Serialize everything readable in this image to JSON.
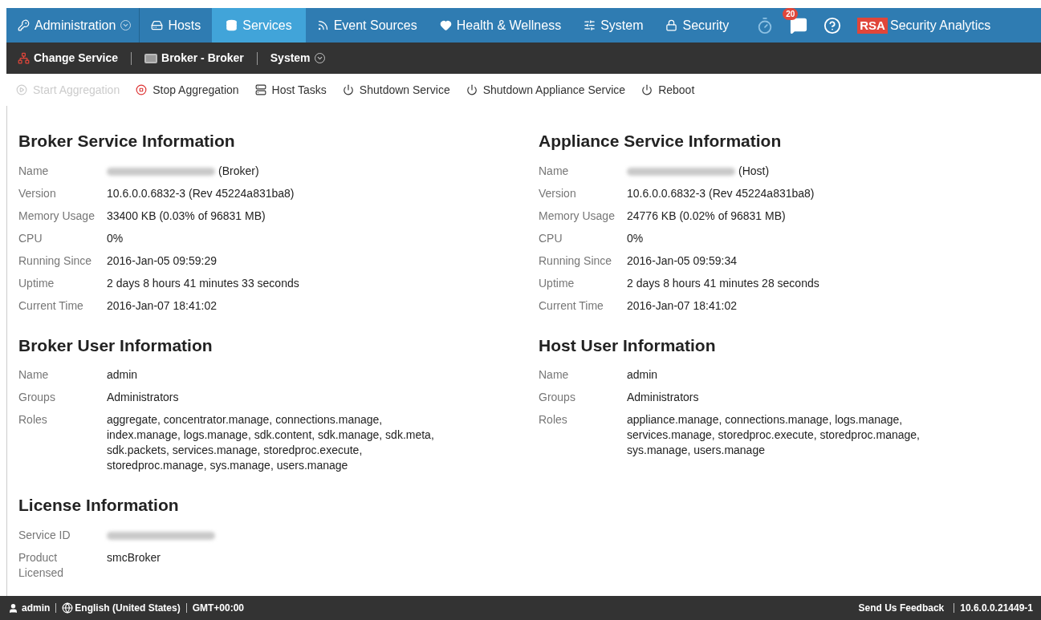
{
  "nav": {
    "tabs": [
      {
        "label": "Administration",
        "dropdown": true,
        "selected": false
      },
      {
        "label": "Hosts",
        "selected": false
      },
      {
        "label": "Services",
        "selected": true
      },
      {
        "label": "Event Sources",
        "selected": false
      },
      {
        "label": "Health & Wellness",
        "selected": false
      },
      {
        "label": "System",
        "selected": false
      },
      {
        "label": "Security",
        "selected": false
      }
    ],
    "notification_count": "20",
    "logo_mark": "RSA",
    "product": "Security Analytics"
  },
  "context_bar": [
    {
      "label": "Change Service"
    },
    {
      "label": "Broker - Broker"
    },
    {
      "label": "System",
      "dropdown": true
    }
  ],
  "toolbar": [
    {
      "label": "Start Aggregation",
      "disabled": true
    },
    {
      "label": "Stop Aggregation",
      "disabled": false
    },
    {
      "label": "Host Tasks",
      "disabled": false
    },
    {
      "label": "Shutdown Service",
      "disabled": false
    },
    {
      "label": "Shutdown Appliance Service",
      "disabled": false
    },
    {
      "label": "Reboot",
      "disabled": false
    }
  ],
  "columns": [
    [
      {
        "title": "Broker Service Information",
        "rows": [
          {
            "label": "Name",
            "value": "(Broker)",
            "redacted": true
          },
          {
            "label": "Version",
            "value": "10.6.0.0.6832-3 (Rev 45224a831ba8)"
          },
          {
            "label": "Memory Usage",
            "value": "33400 KB (0.03% of 96831 MB)"
          },
          {
            "label": "CPU",
            "value": "0%"
          },
          {
            "label": "Running Since",
            "value": "2016-Jan-05 09:59:29"
          },
          {
            "label": "Uptime",
            "value": "2 days 8 hours 41 minutes 33 seconds"
          },
          {
            "label": "Current Time",
            "value": "2016-Jan-07 18:41:02"
          }
        ]
      },
      {
        "title": "Broker User Information",
        "rows": [
          {
            "label": "Name",
            "value": "admin"
          },
          {
            "label": "Groups",
            "value": "Administrators"
          },
          {
            "label": "Roles",
            "value": "aggregate, concentrator.manage, connections.manage, index.manage, logs.manage, sdk.content, sdk.manage, sdk.meta, sdk.packets, services.manage, storedproc.execute, storedproc.manage, sys.manage, users.manage"
          }
        ]
      },
      {
        "title": "License Information",
        "rows": [
          {
            "label": "Service ID",
            "redacted": true
          },
          {
            "label": "Product Licensed",
            "value": "smcBroker"
          }
        ]
      }
    ],
    [
      {
        "title": "Appliance Service Information",
        "rows": [
          {
            "label": "Name",
            "value": "(Host)",
            "redacted": true
          },
          {
            "label": "Version",
            "value": "10.6.0.0.6832-3 (Rev 45224a831ba8)"
          },
          {
            "label": "Memory Usage",
            "value": "24776 KB (0.02% of 96831 MB)"
          },
          {
            "label": "CPU",
            "value": "0%"
          },
          {
            "label": "Running Since",
            "value": "2016-Jan-05 09:59:34"
          },
          {
            "label": "Uptime",
            "value": "2 days 8 hours 41 minutes 28 seconds"
          },
          {
            "label": "Current Time",
            "value": "2016-Jan-07 18:41:02"
          }
        ]
      },
      {
        "title": "Host User Information",
        "rows": [
          {
            "label": "Name",
            "value": "admin"
          },
          {
            "label": "Groups",
            "value": "Administrators"
          },
          {
            "label": "Roles",
            "value": "appliance.manage, connections.manage, logs.manage, services.manage, storedproc.execute, storedproc.manage, sys.manage, users.manage"
          }
        ]
      }
    ]
  ],
  "status_bar": {
    "user": "admin",
    "language": "English (United States)",
    "timezone": "GMT+00:00",
    "feedback": "Send Us Feedback",
    "version": "10.6.0.0.21449-1"
  }
}
